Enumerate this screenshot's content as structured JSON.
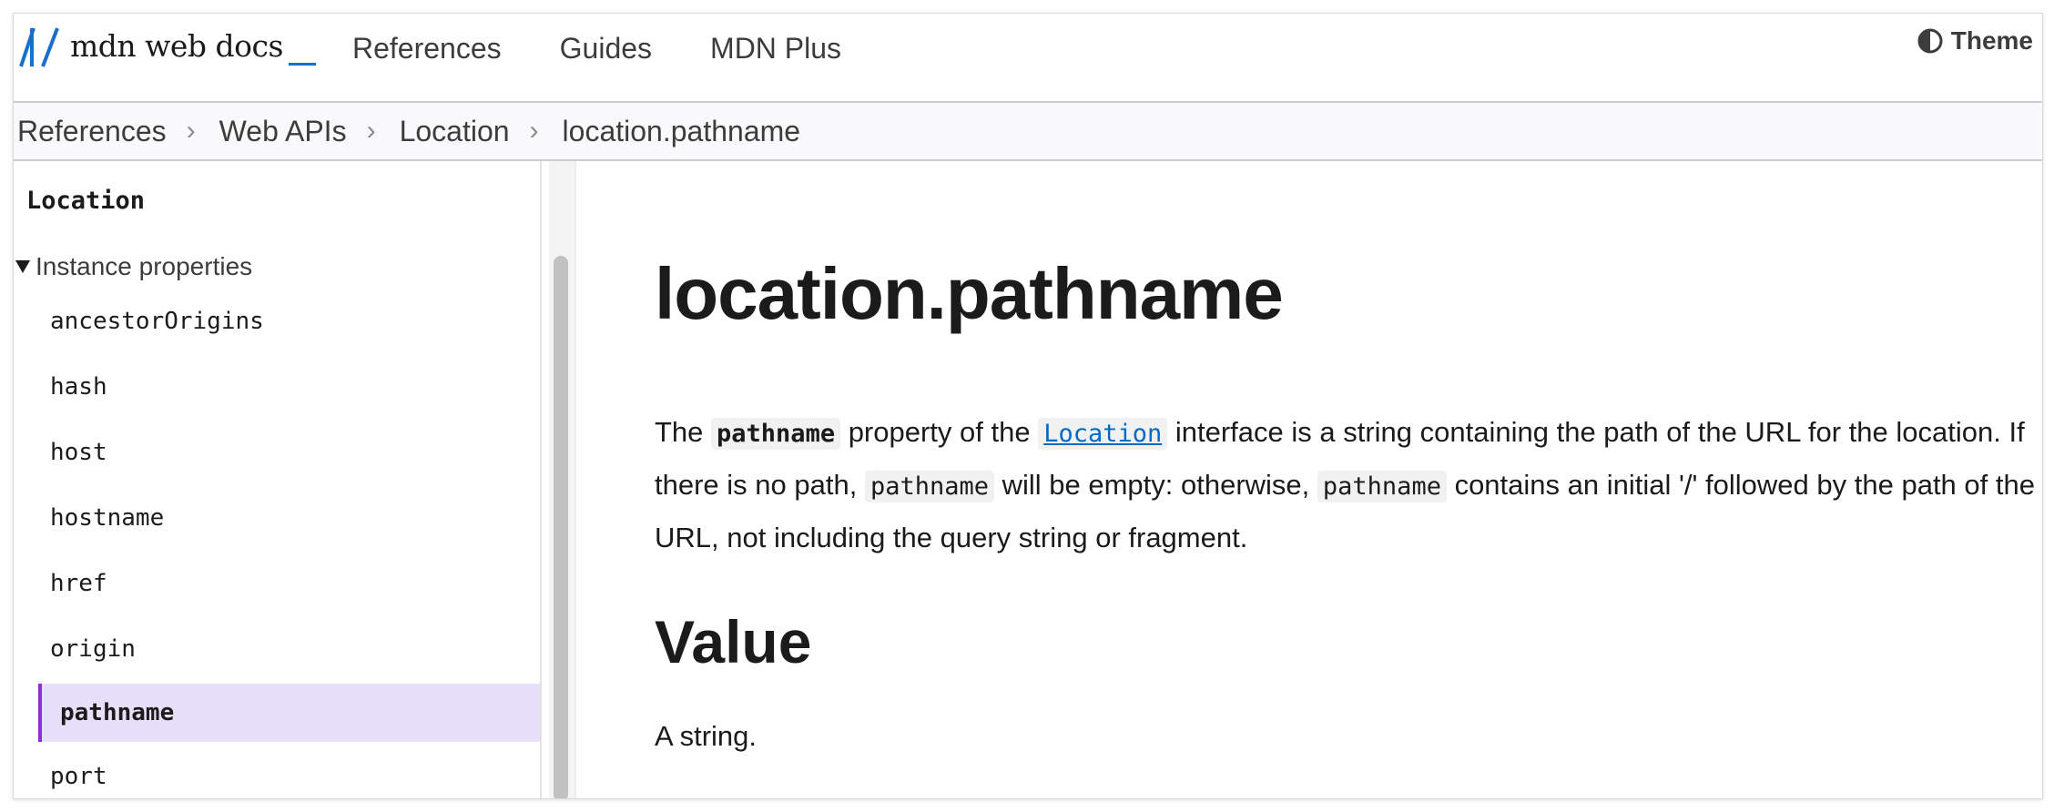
{
  "header": {
    "logo_text": "mdn web docs",
    "nav": [
      "References",
      "Guides",
      "MDN Plus"
    ],
    "theme_label": "Theme"
  },
  "breadcrumb": [
    "References",
    "Web APIs",
    "Location",
    "location.pathname"
  ],
  "breadcrumb_separator": "›",
  "sidebar": {
    "title": "Location",
    "section": "Instance properties",
    "items": [
      "ancestorOrigins",
      "hash",
      "host",
      "hostname",
      "href",
      "origin",
      "pathname",
      "port"
    ],
    "active_item": "pathname"
  },
  "article": {
    "title": "location.pathname",
    "intro": {
      "t1": "The ",
      "c1": "pathname",
      "t2": " property of the ",
      "link": "Location",
      "t3": " interface is a string containing the path of the URL for the location. If there is no path, ",
      "c2": "pathname",
      "t4": " will be empty: otherwise, ",
      "c3": "pathname",
      "t5": " contains an initial '/' followed by the path of the URL, not including the query string or fragment."
    },
    "value_heading": "Value",
    "value_text": "A string."
  },
  "colors": {
    "accent_link": "#0069c2",
    "logo_blue": "#1a6ecc",
    "active_bg": "#e8dffb",
    "active_border": "#8f2cdb"
  }
}
